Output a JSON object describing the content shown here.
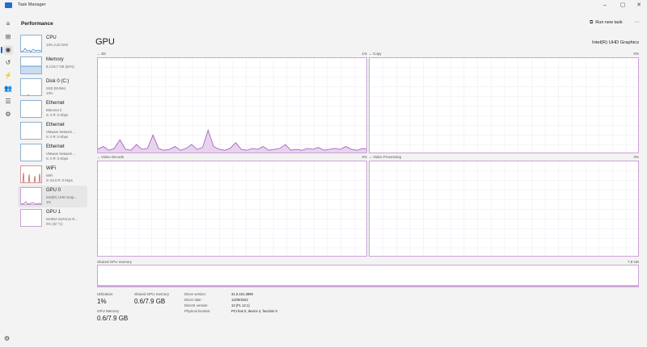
{
  "window": {
    "title": "Task Manager",
    "controls": {
      "minimize": "–",
      "maximize": "▢",
      "close": "✕"
    }
  },
  "header": {
    "title": "Performance",
    "run_new_task": "Run new task",
    "more": "···"
  },
  "rail": [
    {
      "icon": "hamburger-menu-icon",
      "glyph": "≡"
    },
    {
      "icon": "processes-icon",
      "glyph": "⊞"
    },
    {
      "icon": "performance-icon",
      "glyph": "◉"
    },
    {
      "icon": "app-history-icon",
      "glyph": "↺"
    },
    {
      "icon": "startup-apps-icon",
      "glyph": "⚡"
    },
    {
      "icon": "users-icon",
      "glyph": "👥"
    },
    {
      "icon": "details-icon",
      "glyph": "☰"
    },
    {
      "icon": "services-icon",
      "glyph": "⚙"
    }
  ],
  "settings_glyph": "⚙",
  "devices": [
    {
      "name": "CPU",
      "sub1": "13%  2,20 GHz",
      "sub2": ""
    },
    {
      "name": "Memory",
      "sub1": "8,1/15,7 GB (52%)",
      "sub2": ""
    },
    {
      "name": "Disk 0 (C:)",
      "sub1": "SSD (NVMe)",
      "sub2": "13%"
    },
    {
      "name": "Ethernet",
      "sub1": "Ethernet 2",
      "sub2": "S: 0  R: 0 Kbps"
    },
    {
      "name": "Ethernet",
      "sub1": "VMware Network ...",
      "sub2": "S: 0  R: 0 Kbps"
    },
    {
      "name": "Ethernet",
      "sub1": "VMware Network ...",
      "sub2": "S: 0  R: 0 Kbps"
    },
    {
      "name": "WiFi",
      "sub1": "WiFi",
      "sub2": "S: 64.0  R: 0 Kbps"
    },
    {
      "name": "GPU 0",
      "sub1": "Intel(R) UHD Grap...",
      "sub2": "1%"
    },
    {
      "name": "GPU 1",
      "sub1": "NVIDIA GeForce R...",
      "sub2": "0%  (32 °C)"
    }
  ],
  "gpu": {
    "title": "GPU",
    "adapter": "Intel(R) UHD Graphics",
    "engines": [
      {
        "label": "3D",
        "pct": "1%",
        "usage": [
          0.05,
          0.08,
          0.04,
          0.06,
          0.15,
          0.05,
          0.04,
          0.1,
          0.05,
          0.06,
          0.2,
          0.06,
          0.04,
          0.05,
          0.08,
          0.04,
          0.06,
          0.1,
          0.05,
          0.07,
          0.25,
          0.08,
          0.05,
          0.04,
          0.06,
          0.12,
          0.05,
          0.04,
          0.06,
          0.05,
          0.08,
          0.04,
          0.05,
          0.06,
          0.1,
          0.04,
          0.05,
          0.04,
          0.06,
          0.05,
          0.07,
          0.04,
          0.05,
          0.06,
          0.05,
          0.08,
          0.05,
          0.04,
          0.06,
          0.05
        ]
      },
      {
        "label": "Copy",
        "pct": "0%",
        "usage": []
      },
      {
        "label": "Video Decode",
        "pct": "0%",
        "usage": []
      },
      {
        "label": "Video Processing",
        "pct": "0%",
        "usage": []
      }
    ],
    "shared_memory": {
      "label": "Shared GPU memory",
      "max": "7,9 GB"
    },
    "stats": [
      {
        "label": "Utilization",
        "value": "1%"
      },
      {
        "label": "Shared GPU memory",
        "value": "0.6/7.9 GB"
      },
      {
        "label": "GPU Memory",
        "value": "0.6/7.9 GB"
      }
    ],
    "info": [
      {
        "label": "Driver version:",
        "value": "31.0.101.3999"
      },
      {
        "label": "Driver date:",
        "value": "11/05/2022"
      },
      {
        "label": "DirectX version:",
        "value": "12 (FL 12.1)"
      },
      {
        "label": "Physical location:",
        "value": "PCI bus 0, device 2, function 0"
      }
    ]
  }
}
